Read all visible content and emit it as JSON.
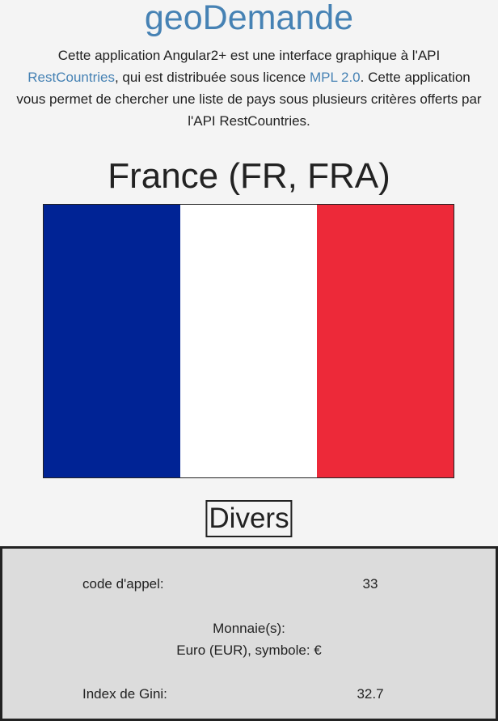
{
  "app": {
    "title": "geoDemande"
  },
  "intro": {
    "text_1": "Cette application Angular2+ est une interface graphique à l'API ",
    "link_restcountries": "RestCountries",
    "text_2": ", qui est distribuée sous licence ",
    "link_license": "MPL 2.0",
    "text_3": ". Cette application vous permet de chercher une liste de pays sous plusieurs critères offerts par l'API RestCountries."
  },
  "country": {
    "title": "France (FR, FRA)",
    "flag_colors": [
      "#002395",
      "#ffffff",
      "#ed2939"
    ]
  },
  "divers": {
    "title": "Divers",
    "calling_code_label": "code d'appel:",
    "calling_code_value": "33",
    "currencies_label": "Monnaie(s):",
    "currencies_value": "Euro (EUR), symbole: €",
    "gini_label": "Index de Gini:",
    "gini_value": "32.7"
  }
}
